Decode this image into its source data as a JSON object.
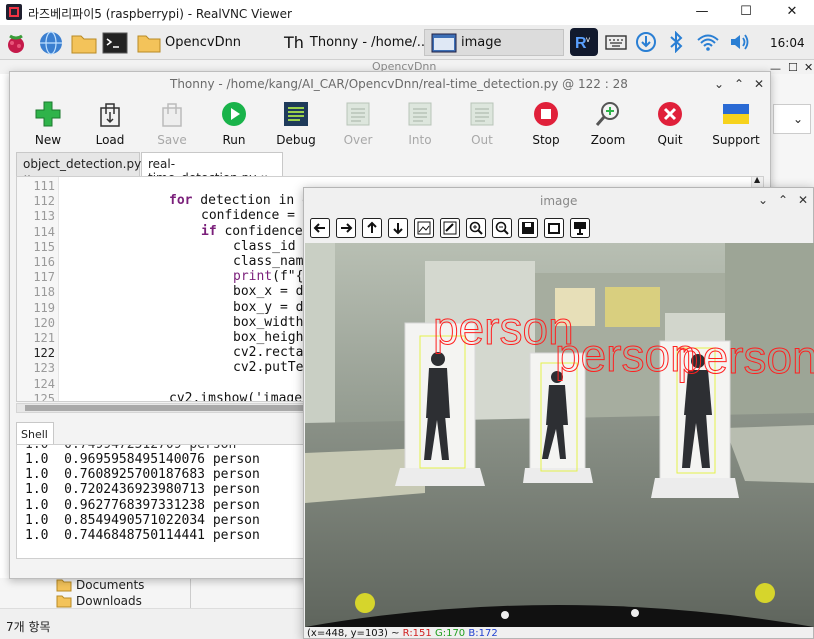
{
  "vnc": {
    "title": "라즈베리파이5 (raspberrypi) - RealVNC Viewer",
    "minimize": "—",
    "maximize": "☐",
    "close": "✕"
  },
  "taskbar": {
    "folder_task": "OpencvDnn",
    "thonny_task": "Thonny  -  /home/...",
    "image_task": "image",
    "clock": "16:04",
    "tray_icons": [
      "realvnc-icon",
      "keyboard-icon",
      "download-icon",
      "bluetooth-icon",
      "wifi-icon",
      "volume-icon"
    ]
  },
  "file_manager": {
    "title": "OpencvDnn",
    "items": [
      "Documents",
      "Downloads"
    ],
    "status": "7개 항목"
  },
  "thonny": {
    "title": "Thonny  -  /home/kang/AI_CAR/OpencvDnn/real-time_detection.py  @  122 : 28",
    "toolbar": [
      {
        "label": "New",
        "icon": "new-icon",
        "enabled": true
      },
      {
        "label": "Load",
        "icon": "load-icon",
        "enabled": true
      },
      {
        "label": "Save",
        "icon": "save-icon",
        "enabled": false
      },
      {
        "label": "Run",
        "icon": "run-icon",
        "enabled": true
      },
      {
        "label": "Debug",
        "icon": "debug-icon",
        "enabled": true
      },
      {
        "label": "Over",
        "icon": "step-over-icon",
        "enabled": false
      },
      {
        "label": "Into",
        "icon": "step-into-icon",
        "enabled": false
      },
      {
        "label": "Out",
        "icon": "step-out-icon",
        "enabled": false
      },
      {
        "label": "Stop",
        "icon": "stop-icon",
        "enabled": true
      },
      {
        "label": "Zoom",
        "icon": "zoom-icon",
        "enabled": true
      },
      {
        "label": "Quit",
        "icon": "quit-icon",
        "enabled": true
      },
      {
        "label": "Support",
        "icon": "support-icon",
        "enabled": true
      }
    ],
    "tabs": [
      {
        "label": "object_detection.py",
        "close": "✖"
      },
      {
        "label": "real-time_detection.py",
        "close": "✖"
      }
    ],
    "line_numbers": [
      "111",
      "112",
      "113",
      "114",
      "115",
      "116",
      "117",
      "118",
      "119",
      "120",
      "121",
      "122",
      "123",
      "124",
      "125"
    ],
    "code": [
      {
        "kw": "",
        "rest": ""
      },
      {
        "kw": "for",
        "rest": " detection in o"
      },
      {
        "kw": "",
        "rest": "confidence = d"
      },
      {
        "kw": "if",
        "rest": " confidence "
      },
      {
        "kw": "",
        "rest": "class_id ="
      },
      {
        "kw": "",
        "rest": "class_name"
      },
      {
        "kw": "print",
        "rest": "(f\"{c"
      },
      {
        "kw": "",
        "rest": "box_x = de"
      },
      {
        "kw": "",
        "rest": "box_y = de"
      },
      {
        "kw": "",
        "rest": "box_width "
      },
      {
        "kw": "",
        "rest": "box_height"
      },
      {
        "kw": "",
        "rest": "cv2.rectan"
      },
      {
        "kw": "",
        "rest": "cv2.putTex"
      },
      {
        "kw": "",
        "rest": ""
      },
      {
        "kw": "",
        "rest": "cv2.imshow('image'"
      }
    ],
    "shell_tab": "Shell",
    "shell_lines": [
      "1.0  0.9695958495140076 person",
      "1.0  0.7608925700187683 person",
      "1.0  0.7202436923980713 person",
      "1.0  0.9627768397331238 person",
      "1.0  0.8549490571022034 person",
      "1.0  0.7446848750114441 person"
    ]
  },
  "image_window": {
    "title": "image",
    "toolbar_icons": [
      "back-icon",
      "forward-icon",
      "up-icon",
      "down-icon",
      "image-icon",
      "image-edit-icon",
      "zoom-in-icon",
      "zoom-out-icon",
      "save-image-icon",
      "copy-icon",
      "properties-icon"
    ],
    "detection_labels": [
      "person",
      "person",
      "person"
    ],
    "coords": "(x=448, y=103) ~ ",
    "r": "R:151",
    "g": "G:170",
    "b": "B:172"
  },
  "colors": {
    "detection_box": "#e5f24a",
    "detection_text": "#ff2020",
    "run": "#19b34a",
    "stop": "#e0203a"
  }
}
